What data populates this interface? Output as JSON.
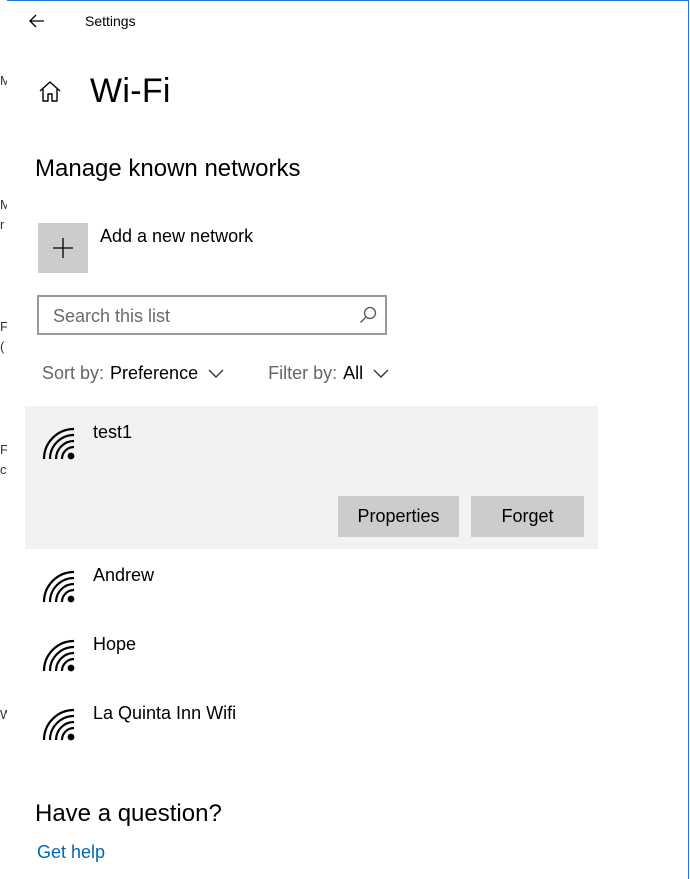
{
  "app": {
    "title": "Settings"
  },
  "page": {
    "title": "Wi-Fi"
  },
  "section": {
    "title": "Manage known networks"
  },
  "add_network": {
    "label": "Add a new network"
  },
  "search": {
    "placeholder": "Search this list"
  },
  "sort": {
    "prefix": "Sort by:",
    "value": "Preference"
  },
  "filter": {
    "prefix": "Filter by:",
    "value": "All"
  },
  "networks": [
    {
      "name": "test1",
      "selected": true
    },
    {
      "name": "Andrew"
    },
    {
      "name": "Hope"
    },
    {
      "name": "La Quinta Inn Wifi"
    }
  ],
  "actions": {
    "properties": "Properties",
    "forget": "Forget"
  },
  "help": {
    "question": "Have a question?",
    "link": "Get help"
  },
  "background_edge_letters": [
    "M",
    "M",
    "r",
    "F",
    "(",
    "F",
    "c",
    "W"
  ],
  "colors": {
    "link": "#0067b8",
    "tile": "#cccccc",
    "selected_bg": "#f2f2f2",
    "window_border": "#1e7bd8"
  },
  "icons": [
    "back-arrow-icon",
    "home-icon",
    "plus-icon",
    "search-icon",
    "chevron-down-icon",
    "wifi-icon"
  ]
}
